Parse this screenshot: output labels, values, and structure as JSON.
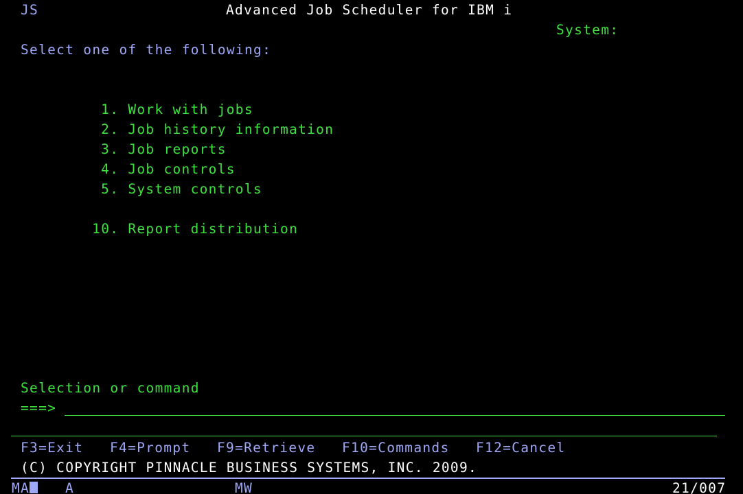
{
  "header": {
    "program_id": "JS",
    "title": "Advanced Job Scheduler for IBM i",
    "system_label": "System:"
  },
  "instruction": "Select one of the following:",
  "menu": {
    "items": [
      {
        "number": "1.",
        "label": "Work with jobs"
      },
      {
        "number": "2.",
        "label": "Job history information"
      },
      {
        "number": "3.",
        "label": "Job reports"
      },
      {
        "number": "4.",
        "label": "Job controls"
      },
      {
        "number": "5.",
        "label": "System controls"
      },
      {
        "number": "10.",
        "label": "Report distribution"
      }
    ]
  },
  "command": {
    "label": "Selection or command",
    "prompt": "===>",
    "value": ""
  },
  "function_keys": [
    {
      "label": "F3=Exit"
    },
    {
      "label": "F4=Prompt"
    },
    {
      "label": "F9=Retrieve"
    },
    {
      "label": "F10=Commands"
    },
    {
      "label": "F12=Cancel"
    }
  ],
  "copyright": "(C) COPYRIGHT PINNACLE BUSINESS SYSTEMS, INC. 2009.",
  "status_bar": {
    "mode": "MA",
    "indicator_a": "A",
    "indicator_mw": "MW",
    "cursor_position": "21/007"
  },
  "colors": {
    "background": "#000000",
    "field_text": "#3ee23e",
    "emphasis_text": "#ffffff",
    "instruction_text": "#9fa8f7"
  }
}
